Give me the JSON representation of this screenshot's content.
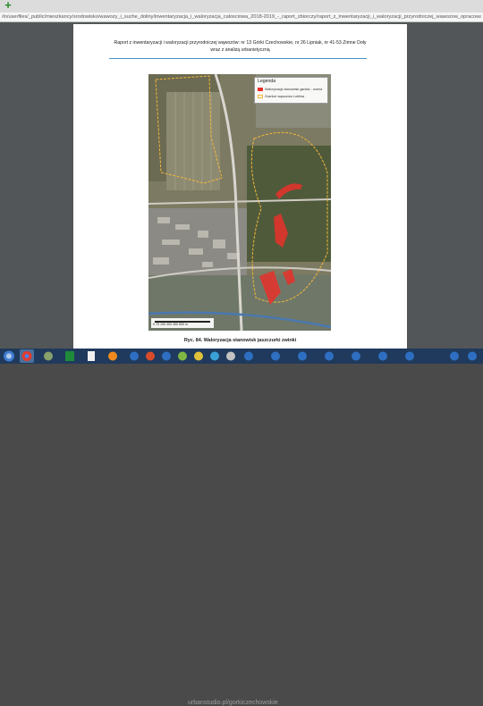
{
  "browser": {
    "new_tab_label": "+",
    "url": "/in/userfiles/_public/mieszkancy/srodowisko/wawozy_i_suche_doliny/inwentaryzacja_i_waloryzacja_calosciowa_2018-2019_-_raport_zbiorczy/raport_z_inwentaryzacji_i_waloryzacji_przyrodniczej_wawozow_opracowanie_calosciowe.pdf"
  },
  "document": {
    "header_line1": "Raport z inwentaryzacji i waloryzacji przyrodniczej wąwozów: nr 13 Górki Czechowskie, nr 26 Lipniak, nr 41-53 Zimne Doły",
    "header_line2": "wraz z analizą urbanistyczną",
    "caption": "Ryc. 84. Waloryzacja stanowisk jaszczurki zwinki"
  },
  "map": {
    "legend_title": "Legenda",
    "legend_items": [
      {
        "label": "Waloryzacja stanowisk gadów - ocena",
        "color": "#e8312a"
      },
      {
        "label": "Granice wąwozów Lublina",
        "color": "#f2b63a"
      }
    ],
    "scale_labels": "0   75  150  300  450  600 m"
  },
  "taskbar": {
    "watermark": "urbanstudio.pl/gorkiczechowskie"
  }
}
